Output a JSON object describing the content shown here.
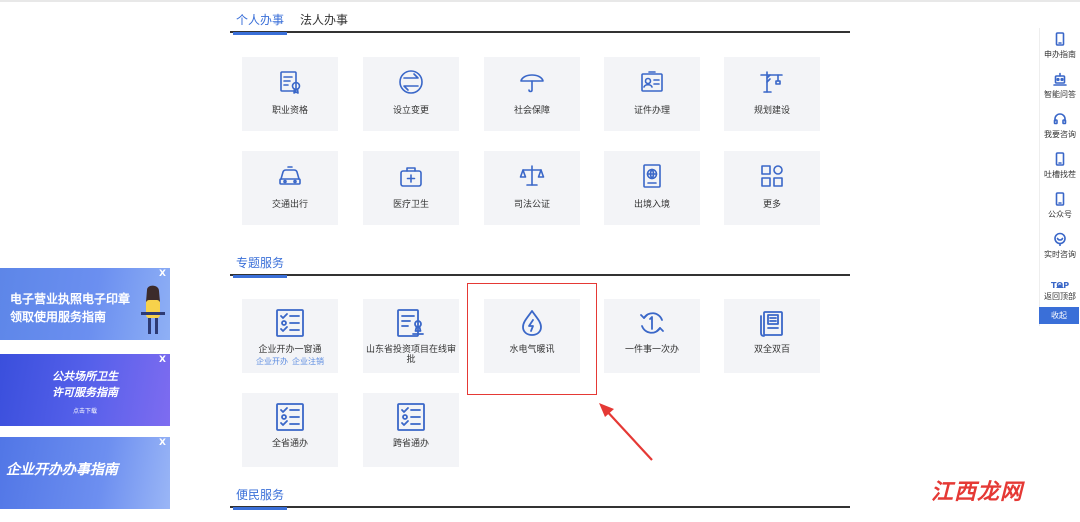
{
  "personal_tabs": [
    {
      "label": "个人办事",
      "active": true
    },
    {
      "label": "法人办事",
      "active": false
    }
  ],
  "personal_services": [
    {
      "label": "职业资格",
      "icon": "certificate-icon"
    },
    {
      "label": "设立变更",
      "icon": "exchange-icon"
    },
    {
      "label": "社会保障",
      "icon": "umbrella-icon"
    },
    {
      "label": "证件办理",
      "icon": "id-card-icon"
    },
    {
      "label": "规划建设",
      "icon": "crane-icon"
    },
    {
      "label": "交通出行",
      "icon": "car-icon"
    },
    {
      "label": "医疗卫生",
      "icon": "medical-kit-icon"
    },
    {
      "label": "司法公证",
      "icon": "scales-icon"
    },
    {
      "label": "出境入境",
      "icon": "passport-icon"
    },
    {
      "label": "更多",
      "icon": "grid-icon"
    }
  ],
  "special_section": {
    "title": "专题服务"
  },
  "special_services": [
    {
      "label": "企业开办一窗通",
      "sub": [
        "企业开办",
        "企业注销"
      ],
      "icon": "checklist-icon"
    },
    {
      "label": "山东省投资项目在线审批",
      "icon": "stamp-form-icon"
    },
    {
      "label": "水电气暖讯",
      "icon": "water-energy-icon"
    },
    {
      "label": "一件事一次办",
      "icon": "cycle-one-icon"
    },
    {
      "label": "双全双百",
      "icon": "document-stack-icon"
    },
    {
      "label": "全省通办",
      "icon": "checklist-icon"
    },
    {
      "label": "跨省通办",
      "icon": "checklist-icon"
    }
  ],
  "convenience_section": {
    "title": "便民服务"
  },
  "banners": {
    "b1": {
      "text": "电子营业执照电子印章领取使用服务指南",
      "close": "X"
    },
    "b2": {
      "line1": "公共场所卫生",
      "line2": "许可服务指南",
      "line3": "点击下载",
      "close": "X"
    },
    "b3": {
      "text": "企业开办办事指南",
      "close": "X"
    }
  },
  "sidebar": {
    "items": [
      {
        "label": "申办指南",
        "icon": "phone-icon"
      },
      {
        "label": "智能问答",
        "icon": "robot-icon"
      },
      {
        "label": "我要咨询",
        "icon": "headset-icon"
      },
      {
        "label": "吐槽找茬",
        "icon": "phone-icon"
      },
      {
        "label": "公众号",
        "icon": "phone-icon"
      },
      {
        "label": "实时咨询",
        "icon": "chat-icon"
      },
      {
        "label": "返回顶部",
        "icon": "top-arrow-icon",
        "top_text": "TOP"
      }
    ],
    "collapse": "收起"
  },
  "watermark": "江西龙网",
  "colors": {
    "accent": "#3a6fd8",
    "highlight": "#e53935",
    "tile_bg": "#f3f4f7"
  }
}
